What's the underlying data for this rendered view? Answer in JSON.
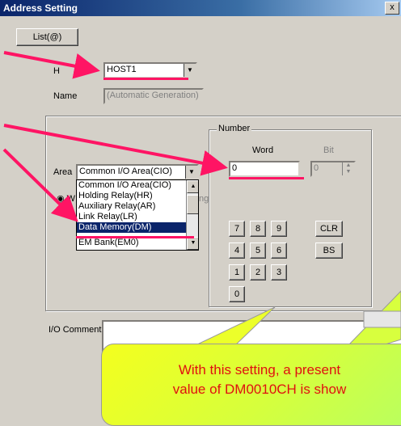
{
  "window": {
    "title": "Address Setting",
    "close_label": "x"
  },
  "list_button": "List(@)",
  "host": {
    "label": "H",
    "value": "HOST1"
  },
  "name": {
    "label": "Name",
    "value": "(Automatic Generation)"
  },
  "area": {
    "label": "Area",
    "value": "Common I/O Area(CIO)",
    "options": [
      "Common I/O Area(CIO)",
      "Holding Relay(HR)",
      "Auxiliary Relay(AR)",
      "Link Relay(LR)",
      "Data Memory(DM)",
      "EM Bank(EM0)"
    ],
    "selected_index": 4,
    "radio_label_visible": "W",
    "partial_text": "ng"
  },
  "number": {
    "group_label": "Number",
    "word_label": "Word",
    "bit_label": "Bit",
    "word_value": "0",
    "bit_value": "0"
  },
  "keypad": {
    "keys": [
      "7",
      "8",
      "9",
      "4",
      "5",
      "6",
      "1",
      "2",
      "3",
      "0"
    ],
    "clr": "CLR",
    "bs": "BS"
  },
  "io_comment": {
    "label": "I/O Comment"
  },
  "callout": {
    "line1": "With this setting, a present",
    "line2": "value of DM0010CH is show"
  },
  "colors": {
    "highlight": "#ff1464",
    "callout_text": "#e01010",
    "title_bar": "#0a246a"
  }
}
